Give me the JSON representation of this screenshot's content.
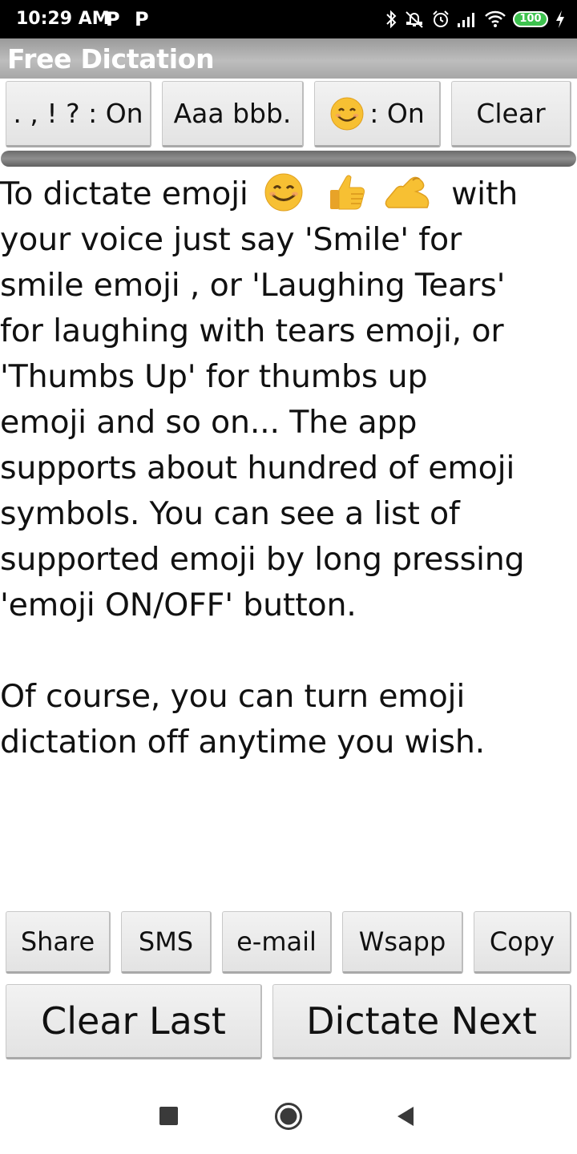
{
  "status_bar": {
    "time": "10:29 AM",
    "notification_icons": [
      "P",
      "P"
    ],
    "battery_level": "100",
    "icons": [
      "bluetooth-icon",
      "mute-icon",
      "alarm-icon",
      "signal-icon",
      "wifi-icon",
      "battery-icon",
      "charging-icon"
    ]
  },
  "app": {
    "title": "Free Dictation"
  },
  "toolbar": {
    "punctuation_label": ". , ! ? : On",
    "capitalize_label": "Aaa bbb.",
    "emoji_label": ": On",
    "clear_label": "Clear"
  },
  "content": {
    "paragraph1_lines": [
      "To dictate emoji",
      "with",
      "your voice just say 'Smile' for",
      "smile emoji , or 'Laughing Tears'",
      "for laughing with tears emoji, or",
      "'Thumbs Up' for thumbs up",
      "emoji  and so on... The app",
      "supports about hundred of emoji",
      "symbols. You can see a list of",
      "supported emoji by long pressing",
      "'emoji ON/OFF' button."
    ],
    "paragraph2_lines": [
      "Of course, you can turn emoji",
      "dictation off anytime you wish."
    ],
    "emojis": [
      "smiling-face-emoji",
      "thumbs-up-emoji",
      "flexed-biceps-emoji"
    ]
  },
  "share_bar": {
    "share_label": "Share",
    "sms_label": "SMS",
    "email_label": "e-mail",
    "whatsapp_label": "Wsapp",
    "copy_label": "Copy"
  },
  "action_bar": {
    "clear_last_label": "Clear Last",
    "dictate_next_label": "Dictate Next"
  },
  "nav_bar": {
    "icons": [
      "recents-icon",
      "home-icon",
      "back-icon"
    ]
  },
  "colors": {
    "status_bar": "#000000",
    "title_bar": "#a9a9a9",
    "button": "#ebebeb",
    "emoji_yellow": "#f7c033",
    "battery_green": "#3ec24f"
  }
}
